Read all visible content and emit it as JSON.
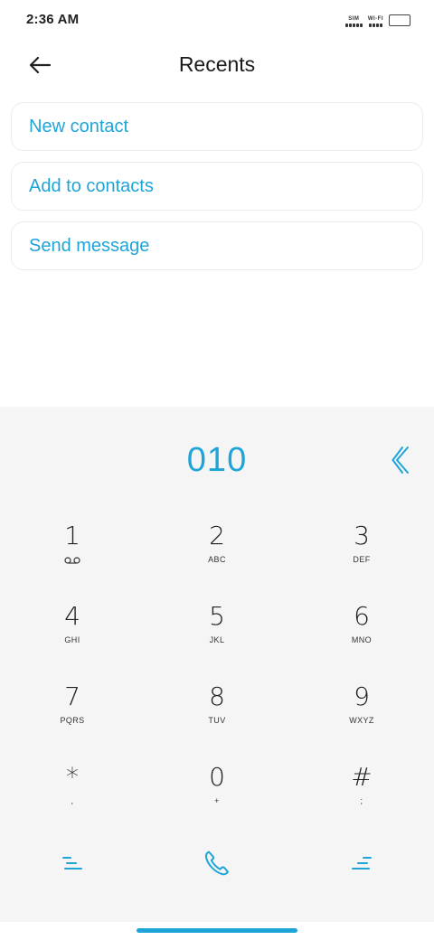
{
  "status_bar": {
    "time": "2:36 AM",
    "sim_label": "SIM",
    "wifi_label": "WI-FI"
  },
  "header": {
    "title": "Recents"
  },
  "actions": [
    {
      "label": "New contact"
    },
    {
      "label": "Add to contacts"
    },
    {
      "label": "Send message"
    }
  ],
  "dialer": {
    "number": "010",
    "keys": [
      {
        "digit": "1",
        "sub": ""
      },
      {
        "digit": "2",
        "sub": "ABC"
      },
      {
        "digit": "3",
        "sub": "DEF"
      },
      {
        "digit": "4",
        "sub": "GHI"
      },
      {
        "digit": "5",
        "sub": "JKL"
      },
      {
        "digit": "6",
        "sub": "MNO"
      },
      {
        "digit": "7",
        "sub": "PQRS"
      },
      {
        "digit": "8",
        "sub": "TUV"
      },
      {
        "digit": "9",
        "sub": "WXYZ"
      },
      {
        "digit": "*",
        "sub": ","
      },
      {
        "digit": "0",
        "sub": "+"
      },
      {
        "digit": "#",
        "sub": ";"
      }
    ]
  },
  "colors": {
    "accent": "#1ea5d8",
    "dialer_bg": "#f5f5f5"
  },
  "icons": {
    "back": "arrow-left-icon",
    "backspace": "backspace-chevron-icon",
    "voicemail": "voicemail-icon",
    "menu_left": "menu-lines-icon",
    "call": "phone-icon",
    "menu_right": "menu-lines-icon"
  }
}
